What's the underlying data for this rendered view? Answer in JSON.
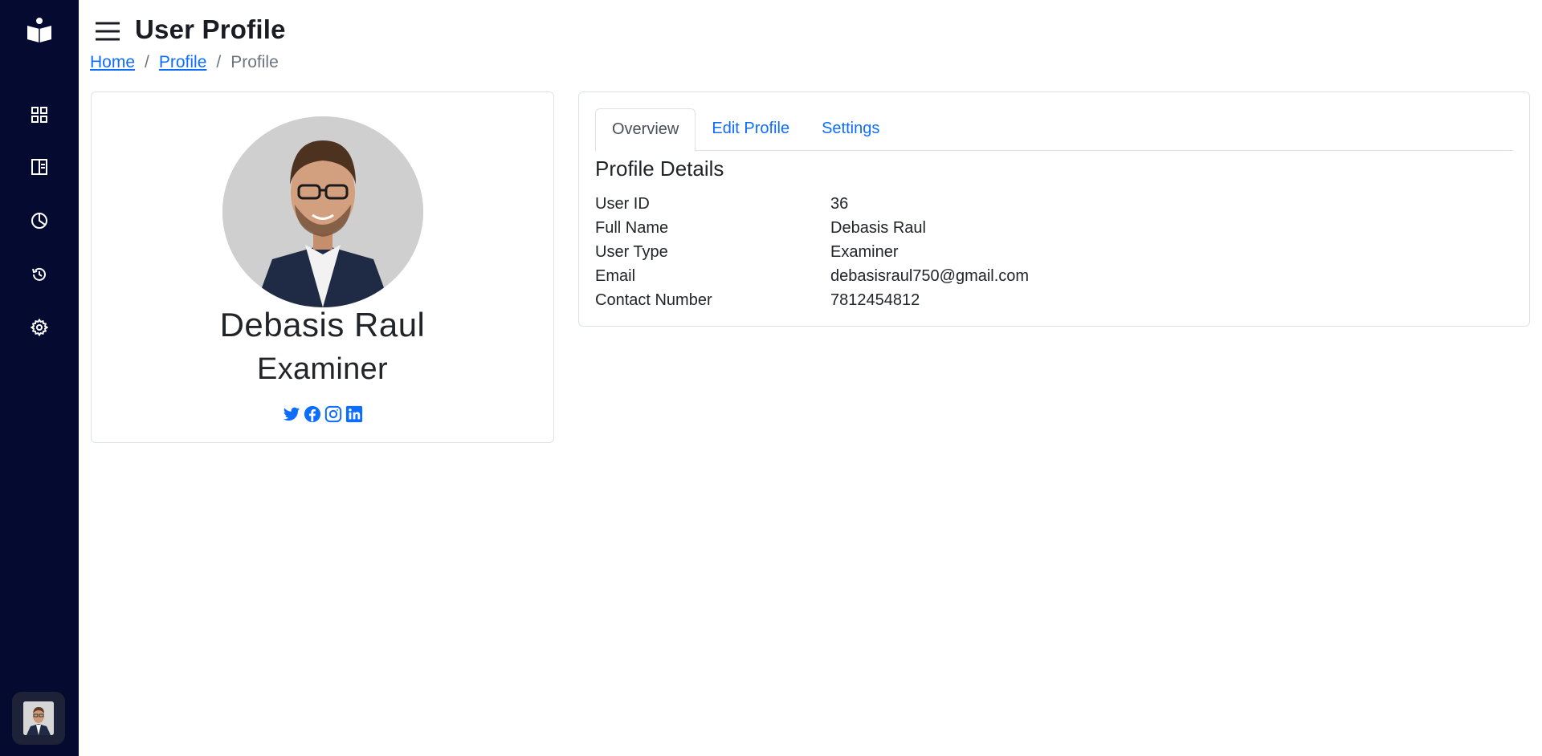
{
  "header": {
    "title": "User Profile"
  },
  "breadcrumb": [
    {
      "label": "Home",
      "link": true
    },
    {
      "label": "Profile",
      "link": true
    },
    {
      "label": "Profile",
      "link": false
    }
  ],
  "sidebar": {
    "items": [
      {
        "icon": "dashboard-grid-icon"
      },
      {
        "icon": "layout-panel-icon"
      },
      {
        "icon": "pie-chart-icon"
      },
      {
        "icon": "history-icon"
      },
      {
        "icon": "gear-icon"
      }
    ]
  },
  "profile_card": {
    "name": "Debasis Raul",
    "role": "Examiner",
    "socials": [
      "twitter-icon",
      "facebook-icon",
      "instagram-icon",
      "linkedin-icon"
    ]
  },
  "tabs": [
    {
      "label": "Overview",
      "active": true
    },
    {
      "label": "Edit Profile",
      "active": false
    },
    {
      "label": "Settings",
      "active": false
    }
  ],
  "details": {
    "title": "Profile Details",
    "rows": [
      {
        "label": "User ID",
        "value": "36"
      },
      {
        "label": "Full Name",
        "value": "Debasis Raul"
      },
      {
        "label": "User Type",
        "value": "Examiner"
      },
      {
        "label": "Email",
        "value": "debasisraul750@gmail.com"
      },
      {
        "label": "Contact Number",
        "value": "7812454812"
      }
    ]
  },
  "colors": {
    "sidebar_bg": "#050a30",
    "link": "#0d6efd",
    "text": "#212529"
  }
}
